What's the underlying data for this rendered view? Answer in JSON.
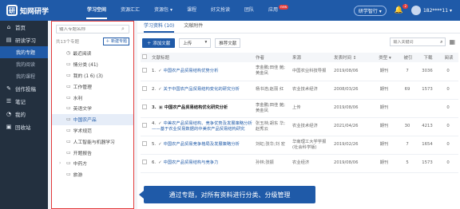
{
  "header": {
    "logo_text": "知网研学",
    "logo_mark": "研",
    "nav": [
      {
        "label": "学习空间",
        "active": true
      },
      {
        "label": "资源汇汇",
        "active": false
      },
      {
        "label": "资源包 ▾",
        "active": false
      },
      {
        "label": "课程",
        "active": false
      },
      {
        "label": "好文抢读",
        "active": false
      },
      {
        "label": "团队",
        "active": false
      },
      {
        "label": "应用",
        "active": false,
        "badge": "new"
      }
    ],
    "assistant_label": "研学智行 ▾",
    "bell_count": "2",
    "username": "182****11 ▾"
  },
  "sidebar": {
    "items": [
      {
        "icon": "⌂",
        "label": "首页",
        "type": "item"
      },
      {
        "icon": "▤",
        "label": "研读学习",
        "type": "item"
      },
      {
        "label": "我的专题",
        "type": "sub",
        "active": true
      },
      {
        "label": "我的阅读",
        "type": "sub"
      },
      {
        "label": "我的课程",
        "type": "sub"
      },
      {
        "icon": "✎",
        "label": "创作投稿",
        "type": "item"
      },
      {
        "icon": "☰",
        "label": "笔记",
        "type": "item"
      },
      {
        "icon": "◔",
        "label": "我的",
        "type": "item"
      },
      {
        "icon": "▣",
        "label": "回收站",
        "type": "item"
      }
    ]
  },
  "topic_panel": {
    "search_placeholder": "输入专题名称",
    "count_label": "共13个专题",
    "new_button": "＋ 新建专题",
    "topics": [
      {
        "label": "最近阅读",
        "icon": "◷",
        "active": false,
        "arrow": false
      },
      {
        "label": "情分类 (41)",
        "icon": "▭",
        "active": false,
        "arrow": false
      },
      {
        "label": "我的 (1 6) (3)",
        "icon": "▭",
        "active": false,
        "arrow": false
      },
      {
        "label": "工作管理",
        "icon": "▭",
        "active": false,
        "arrow": false
      },
      {
        "label": "水利",
        "icon": "▭",
        "active": false,
        "arrow": false
      },
      {
        "label": "英语文学",
        "icon": "▭",
        "active": false,
        "arrow": false
      },
      {
        "label": "中国农产品",
        "icon": "▭",
        "active": true,
        "arrow": false
      },
      {
        "label": "学术规范",
        "icon": "▭",
        "active": false,
        "arrow": false
      },
      {
        "label": "人工智能与机器学习",
        "icon": "▭",
        "active": false,
        "arrow": false
      },
      {
        "label": "开题报告",
        "icon": "▭",
        "active": false,
        "arrow": false
      },
      {
        "label": "中药方",
        "icon": "▭",
        "active": false,
        "arrow": true
      },
      {
        "label": "旅游",
        "icon": "▭",
        "active": false,
        "arrow": false
      }
    ]
  },
  "main": {
    "tabs": [
      {
        "label": "学习资料 (10)",
        "active": true
      },
      {
        "label": "文献附件",
        "active": false
      }
    ],
    "toolbar": {
      "add_button": "＋ 添加文献",
      "select_label": "上传",
      "plain_button": "推荐文献",
      "search_placeholder": "输入关键词",
      "grid_icon": "▦"
    },
    "columns": [
      "",
      "文献标题",
      "作者",
      "来源",
      "发表时间 ↕",
      "类型 ▾",
      "被引",
      "下载",
      "阅读"
    ],
    "rows": [
      {
        "num": "1.",
        "mark": "✓",
        "title": "中国农产品贸易结构优势分析",
        "bold": false,
        "author": "李金鹏;田佳 鲍;黄金凤",
        "source": "中国农业科技导报",
        "date": "2019/08/06",
        "type": "期刊",
        "cited": "7",
        "downloads": "3036",
        "reads": "0"
      },
      {
        "num": "2.",
        "mark": "✓",
        "title": "关于中国农产品贸易结构变化的研究分析",
        "bold": false,
        "author": "杨书浩;赵丽 红",
        "source": "农业技术经济",
        "date": "2008/03/26",
        "type": "期刊",
        "cited": "69",
        "downloads": "1573",
        "reads": "0"
      },
      {
        "num": "3.",
        "mark": "▣",
        "title": "中国农产品贸易结构优化研究分析",
        "bold": true,
        "author": "李金鹏;田佳 鲍;黄金凤",
        "source": "上传",
        "date": "2019/08/06",
        "type": "期刊",
        "cited": "",
        "downloads": "",
        "reads": "0"
      },
      {
        "num": "4.",
        "mark": "✓",
        "title": "中美农产品贸易结构、竞争优势及发展策略分析——基于农业贸易数据的中美农产品贸易结构研究",
        "bold": false,
        "author": "张玉林;胡东 华;赵秀云",
        "source": "农业技术经济",
        "date": "2021/04/26",
        "type": "期刊",
        "cited": "30",
        "downloads": "4213",
        "reads": "0"
      },
      {
        "num": "5.",
        "mark": "✓",
        "title": "中国农产品贸易竞争格局及发展策略分析",
        "bold": false,
        "author": "刘虹;张华;刘 宏",
        "source": "华南理工大学学报(社会科学版)",
        "date": "2019/02/26",
        "type": "期刊",
        "cited": "7",
        "downloads": "1654",
        "reads": "0"
      },
      {
        "num": "6.",
        "mark": "✓",
        "title": "中国农产品贸易结构与竞争力",
        "bold": false,
        "author": "孙林;张振",
        "source": "农业经济",
        "date": "2019/08/06",
        "type": "期刊",
        "cited": "5",
        "downloads": "1573",
        "reads": "0"
      }
    ]
  },
  "tooltip_text": "通过专题，对所有资料进行分类、分级管理"
}
